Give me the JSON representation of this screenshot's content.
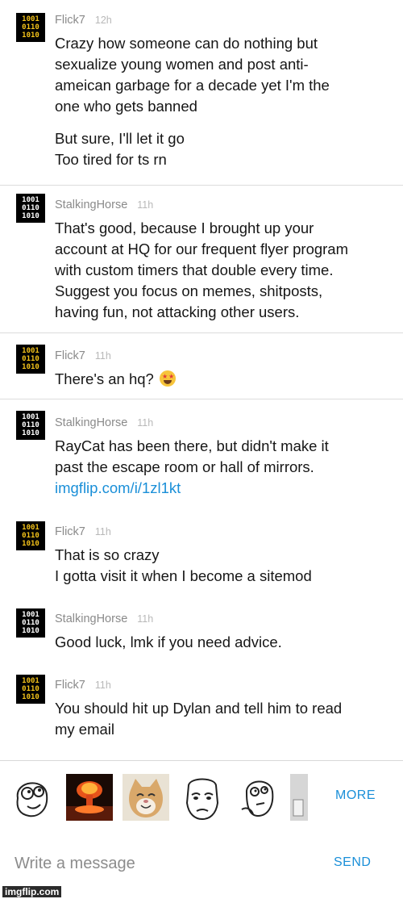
{
  "messages": [
    {
      "user": "Flick7",
      "time": "12h",
      "avatar": "gold",
      "lines": [
        "Crazy how someone can do nothing but",
        "sexualize young women and post anti-",
        "ameican garbage for a decade yet I'm the",
        "one who gets banned"
      ],
      "extra_lines": [
        "But sure, I'll let it go",
        "Too tired for ts rn"
      ]
    },
    {
      "user": "StalkingHorse",
      "time": "11h",
      "avatar": "white",
      "lines": [
        "That's good, because I brought up your",
        "account at HQ for our frequent flyer program",
        "with custom timers that double every time.",
        "Suggest you focus on memes, shitposts,",
        "having fun, not attacking other users."
      ]
    },
    {
      "user": "Flick7",
      "time": "11h",
      "avatar": "gold",
      "lines": [
        "There's an hq?"
      ],
      "emoji": "star-struck-emoji"
    },
    {
      "user": "StalkingHorse",
      "time": "11h",
      "avatar": "white",
      "lines": [
        "RayCat has been there, but didn't make it",
        "past the escape room or hall of mirrors."
      ],
      "link": "imgflip.com/i/1zl1kt"
    },
    {
      "user": "Flick7",
      "time": "11h",
      "avatar": "gold",
      "lines": [
        "That is so crazy",
        "I gotta visit it when I become a sitemod"
      ]
    },
    {
      "user": "StalkingHorse",
      "time": "11h",
      "avatar": "white",
      "lines": [
        "Good luck, lmk if you need advice."
      ]
    },
    {
      "user": "Flick7",
      "time": "11h",
      "avatar": "gold",
      "lines": [
        "You should hit up Dylan and tell him to read",
        "my email"
      ]
    }
  ],
  "avatar_text": [
    "1001",
    "0110",
    "1010"
  ],
  "stickers": [
    "derp-face-sticker",
    "nuclear-explosion-sticker",
    "happy-cat-sticker",
    "okay-face-sticker",
    "thinking-rage-face-sticker",
    "partial-sticker"
  ],
  "sticker_more_label": "MORE",
  "composer": {
    "placeholder": "Write a message",
    "send_label": "SEND"
  },
  "watermark": "imgflip.com",
  "colors": {
    "accent": "#1a8fd8",
    "avatar_gold": "#f3c21a",
    "username": "#8a8a8a"
  }
}
